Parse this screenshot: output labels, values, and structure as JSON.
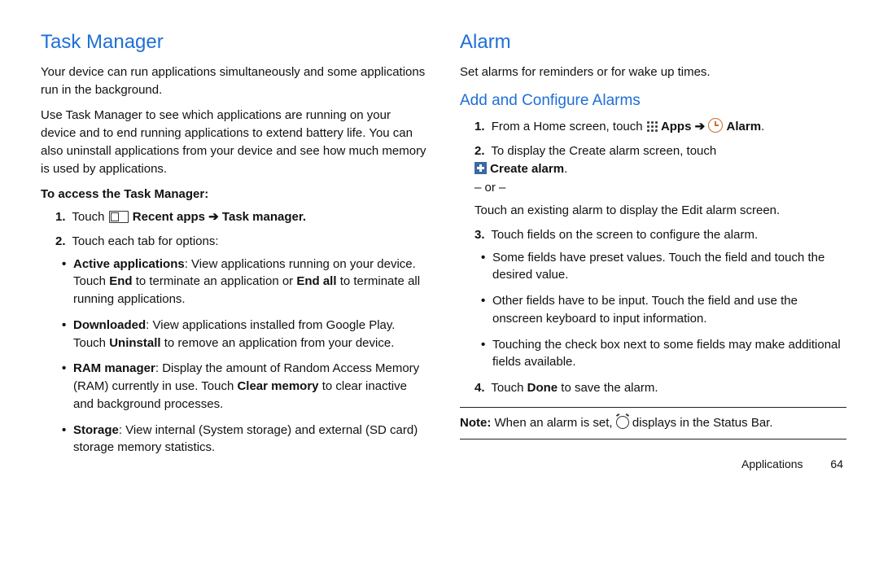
{
  "left": {
    "heading": "Task Manager",
    "para1": "Your device can run applications simultaneously and some applications run in the background.",
    "para2": "Use Task Manager to see which applications are running on your device and to end running applications to extend battery life. You can also uninstall applications from your device and see how much memory is used by applications.",
    "subhead": "To access the Task Manager:",
    "step1_a": "Touch ",
    "step1_b": "Recent apps",
    "step1_c": "Task manager.",
    "step2": "Touch each tab for options:",
    "bul1_title": "Active applications",
    "bul1_a": ": View applications running on your device. Touch ",
    "bul1_b": "End",
    "bul1_c": " to terminate an application or ",
    "bul1_d": "End all",
    "bul1_e": " to terminate all running applications.",
    "bul2_title": "Downloaded",
    "bul2_a": ": View applications installed from Google Play. Touch ",
    "bul2_b": "Uninstall",
    "bul2_c": " to remove an application from your device.",
    "bul3_title": "RAM manager",
    "bul3_a": ": Display the amount of Random Access Memory (RAM) currently in use. Touch ",
    "bul3_b": "Clear memory",
    "bul3_c": " to clear inactive and background processes.",
    "bul4_title": "Storage",
    "bul4_a": ": View internal (System storage) and external (SD card) storage memory statistics."
  },
  "right": {
    "heading": "Alarm",
    "para1": "Set alarms for reminders or for wake up times.",
    "subheading": "Add and Configure Alarms",
    "s1_a": "From a Home screen, touch ",
    "s1_b": "Apps",
    "s1_c": "Alarm",
    "s1_d": ".",
    "s2_a": "To display the Create alarm screen, touch ",
    "s2_b": "Create alarm",
    "s2_c": ".",
    "or": "– or –",
    "s2_d": "Touch an existing alarm to display the Edit alarm screen.",
    "s3": "Touch fields on the screen to configure the alarm.",
    "s3_b1": "Some fields have preset values. Touch the field and touch the desired value.",
    "s3_b2": "Other fields have to be input. Touch the field and use the onscreen keyboard to input information.",
    "s3_b3": "Touching the check box next to some fields may make additional fields available.",
    "s4_a": "Touch ",
    "s4_b": "Done",
    "s4_c": " to save the alarm.",
    "note_a": "Note:",
    "note_b": " When an alarm is set, ",
    "note_c": " displays in the Status Bar.",
    "footer_label": "Applications",
    "footer_page": "64"
  },
  "arrow": "➔"
}
